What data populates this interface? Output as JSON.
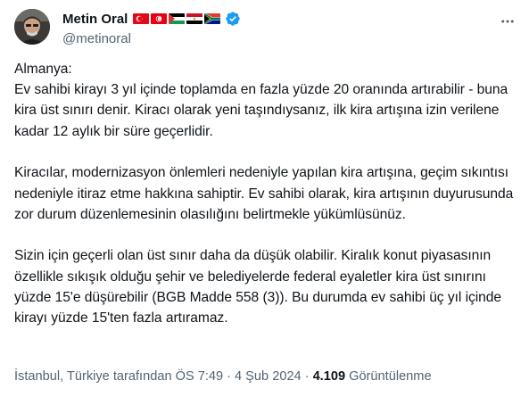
{
  "author": {
    "display_name": "Metin Oral",
    "handle": "@metinoral",
    "verified": true,
    "flags": [
      "turkey-flag",
      "tunisia-flag",
      "palestine-flag",
      "egypt-flag",
      "south-africa-flag"
    ]
  },
  "tweet": {
    "paragraphs": [
      "Almanya:\nEv sahibi kirayı 3 yıl içinde toplamda en fazla yüzde 20 oranında artırabilir - buna kira üst sınırı denir. Kiracı olarak yeni taşındıysanız, ilk kira artışına izin verilene kadar 12 aylık bir süre geçerlidir.",
      "Kiracılar, modernizasyon önlemleri nedeniyle yapılan kira artışına, geçim sıkıntısı nedeniyle itiraz etme hakkına sahiptir. Ev sahibi olarak, kira artışının duyurusunda zor durum düzenlemesinin olasılığını belirtmekle yükümlüsünüz.",
      "Sizin için geçerli olan üst sınır daha da düşük olabilir. Kiralık konut piyasasının özellikle sıkışık olduğu şehir ve belediyelerde federal eyaletler kira üst sınırını yüzde 15'e düşürebilir (BGB Madde 558 (3)). Bu durumda ev sahibi üç yıl içinde kirayı yüzde 15'ten fazla artıramaz."
    ]
  },
  "meta": {
    "translated_from": "İstanbul, Türkiye tarafından",
    "time": "ÖS 7:49",
    "separator": "·",
    "date": "4 Şub 2024",
    "views_count": "4.109",
    "views_label": "Görüntülenme"
  },
  "colors": {
    "verified": "#1d9bf0",
    "text": "#0f1419",
    "secondary": "#536471"
  }
}
